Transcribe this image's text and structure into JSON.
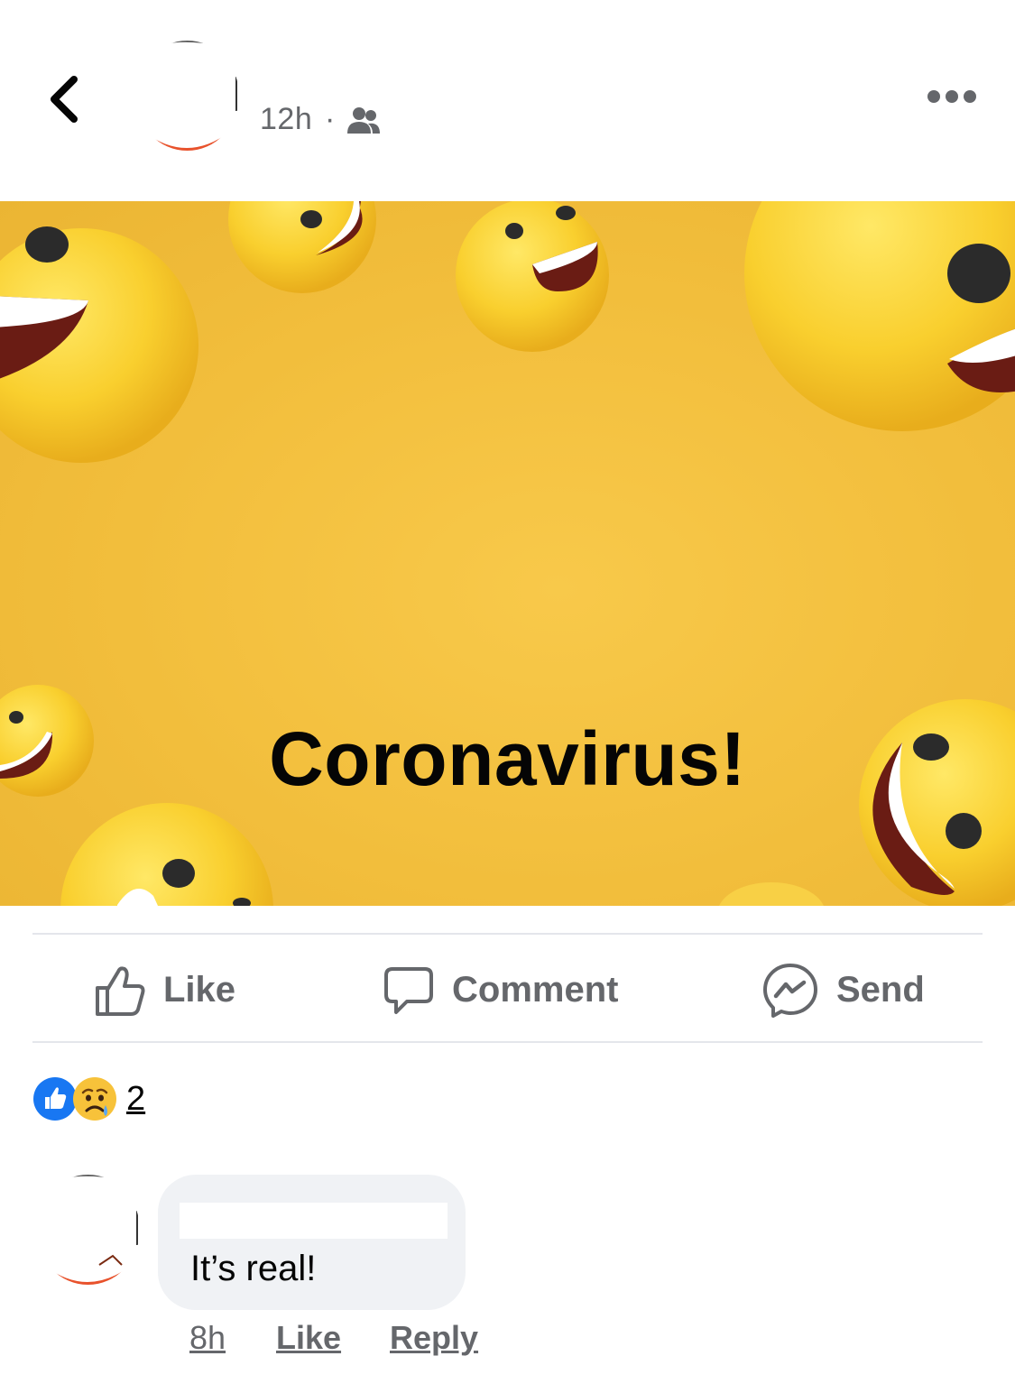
{
  "header": {
    "timestamp": "12h",
    "separator": "·",
    "audience_icon": "friends-icon",
    "more_icon": "more-icon"
  },
  "post": {
    "image_text": "Coronavirus!",
    "background_color": "#f2be3c"
  },
  "actions": {
    "like_label": "Like",
    "comment_label": "Comment",
    "send_label": "Send"
  },
  "reactions": {
    "icons": [
      "like-reaction-icon",
      "sad-reaction-icon"
    ],
    "count": "2"
  },
  "comment": {
    "text": "It’s real!",
    "time": "8h",
    "like_label": "Like",
    "reply_label": "Reply"
  },
  "colors": {
    "meta_gray": "#65676b",
    "like_blue": "#1877f2",
    "bubble_bg": "#f0f2f5"
  }
}
